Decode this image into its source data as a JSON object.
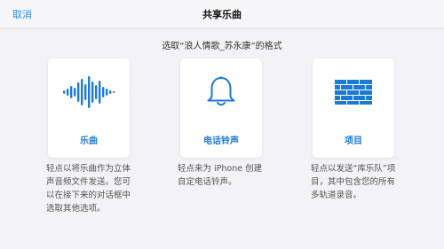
{
  "header": {
    "cancel_label": "取消",
    "title": "共享乐曲"
  },
  "subtitle": "选取“浪人情歌_苏永康”的格式",
  "options": [
    {
      "label": "乐曲",
      "icon": "waveform-icon",
      "description": "轻点以将乐曲作为立体声音频文件发送。您可以在接下来的对话框中选取其他选项。"
    },
    {
      "label": "电话铃声",
      "icon": "bell-icon",
      "description": "轻点来为 iPhone 创建自定电话铃声。"
    },
    {
      "label": "项目",
      "icon": "brick-wall-icon",
      "description": "轻点以发送“库乐队”项目，其中包含您的所有多轨道录音。"
    }
  ],
  "colors": {
    "accent": "#1c79d4",
    "link": "#1f8ef1",
    "background": "#f2f2f7"
  }
}
